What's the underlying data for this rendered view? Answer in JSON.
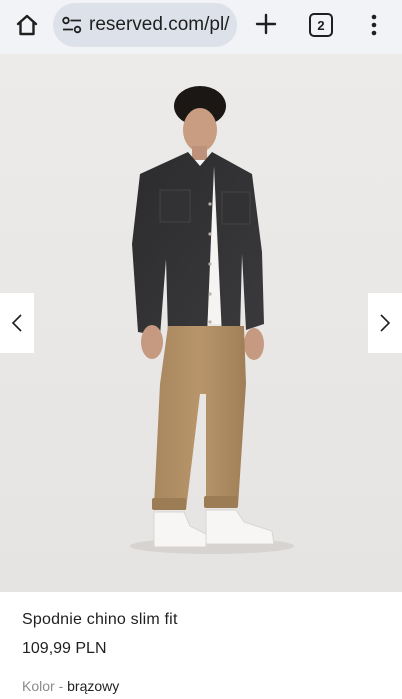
{
  "browser": {
    "url_text": "reserved.com/pl/",
    "tab_count": "2",
    "icons": {
      "home": "home-icon",
      "site_info": "site-settings-icon",
      "new_tab": "plus-icon",
      "menu": "more-vert-icon"
    }
  },
  "gallery": {
    "prev_icon": "chevron-left-icon",
    "next_icon": "chevron-right-icon"
  },
  "product": {
    "name": "Spodnie chino slim fit",
    "price": "109,99 PLN",
    "color_label": "Kolor",
    "color_separator": "-",
    "color_value": "brązowy"
  },
  "colors": {
    "toolbar_bg": "#f2f3f6",
    "omnibox_bg": "#dde2ea",
    "image_bg": "#ebe9e7",
    "text": "#1f1f1f",
    "muted_text": "#8a8a8a"
  }
}
